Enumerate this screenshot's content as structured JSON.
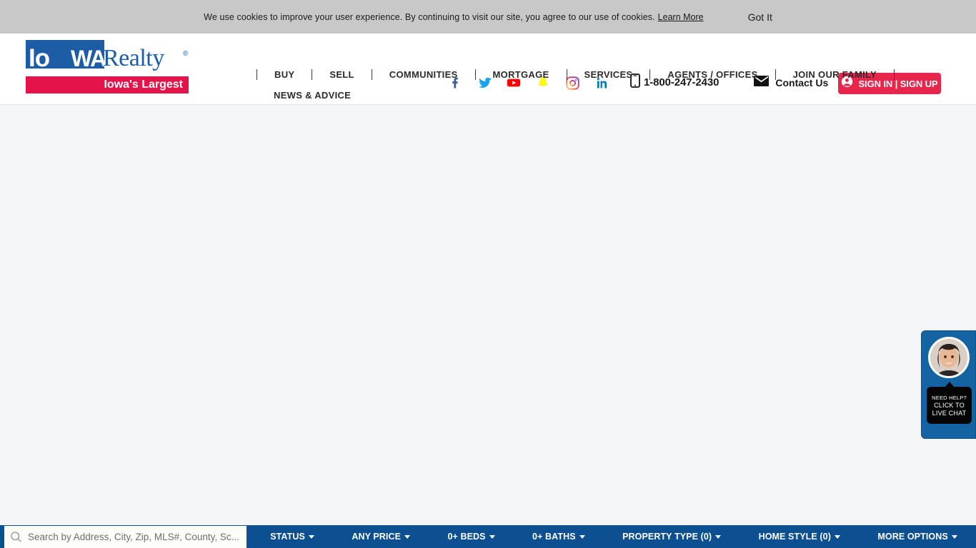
{
  "cookie_banner": {
    "message": "We use cookies to improve your user experience. By continuing to visit our site, you agree to our use of cookies.",
    "learn_more": "Learn More",
    "accept": "Got It",
    "background_color": "#c8c8c8"
  },
  "header": {
    "logo": {
      "brand_iowa": "Io",
      "brand_wa": "WA",
      "brand_realty": "Realty",
      "registered": "®",
      "tagline": "Iowa's Largest",
      "blue_color": "#1d5da6",
      "red_color": "#e4134a"
    },
    "social": [
      {
        "name": "facebook-icon",
        "label": "Facebook",
        "color": "#3b5998"
      },
      {
        "name": "twitter-icon",
        "label": "Twitter",
        "color": "#1da1f2"
      },
      {
        "name": "youtube-icon",
        "label": "YouTube",
        "color": "#ff0000"
      },
      {
        "name": "snapchat-icon",
        "label": "Snapchat",
        "color": "#fffc00"
      },
      {
        "name": "instagram-icon",
        "label": "Instagram",
        "color": "#e1306c"
      },
      {
        "name": "linkedin-icon",
        "label": "LinkedIn",
        "color": "#0077b5"
      }
    ],
    "phone": "1-800-247-2430",
    "contact_us": "Contact Us",
    "sign_in": "SIGN IN | SIGN UP",
    "sign_in_color": "#e8264b"
  },
  "nav": {
    "items": [
      "BUY",
      "SELL",
      "COMMUNITIES",
      "MORTGAGE",
      "SERVICES",
      "AGENTS / OFFICES",
      "JOIN OUR FAMILY",
      "NEWS & ADVICE"
    ]
  },
  "chat_widget": {
    "line1": "NEED HELP?",
    "line2": "CLICK TO",
    "line3": "LIVE CHAT",
    "panel_color": "#1463a3"
  },
  "search_bar": {
    "placeholder": "Search by Address, City, Zip, MLS#, County, Sc...",
    "icon": "search-icon",
    "bar_color": "#0d5091",
    "filters": [
      {
        "label": "STATUS"
      },
      {
        "label": "ANY PRICE"
      },
      {
        "label": "0+ BEDS"
      },
      {
        "label": "0+ BATHS"
      },
      {
        "label": "PROPERTY TYPE (0)"
      },
      {
        "label": "HOME STYLE (0)"
      },
      {
        "label": "MORE OPTIONS"
      }
    ]
  }
}
